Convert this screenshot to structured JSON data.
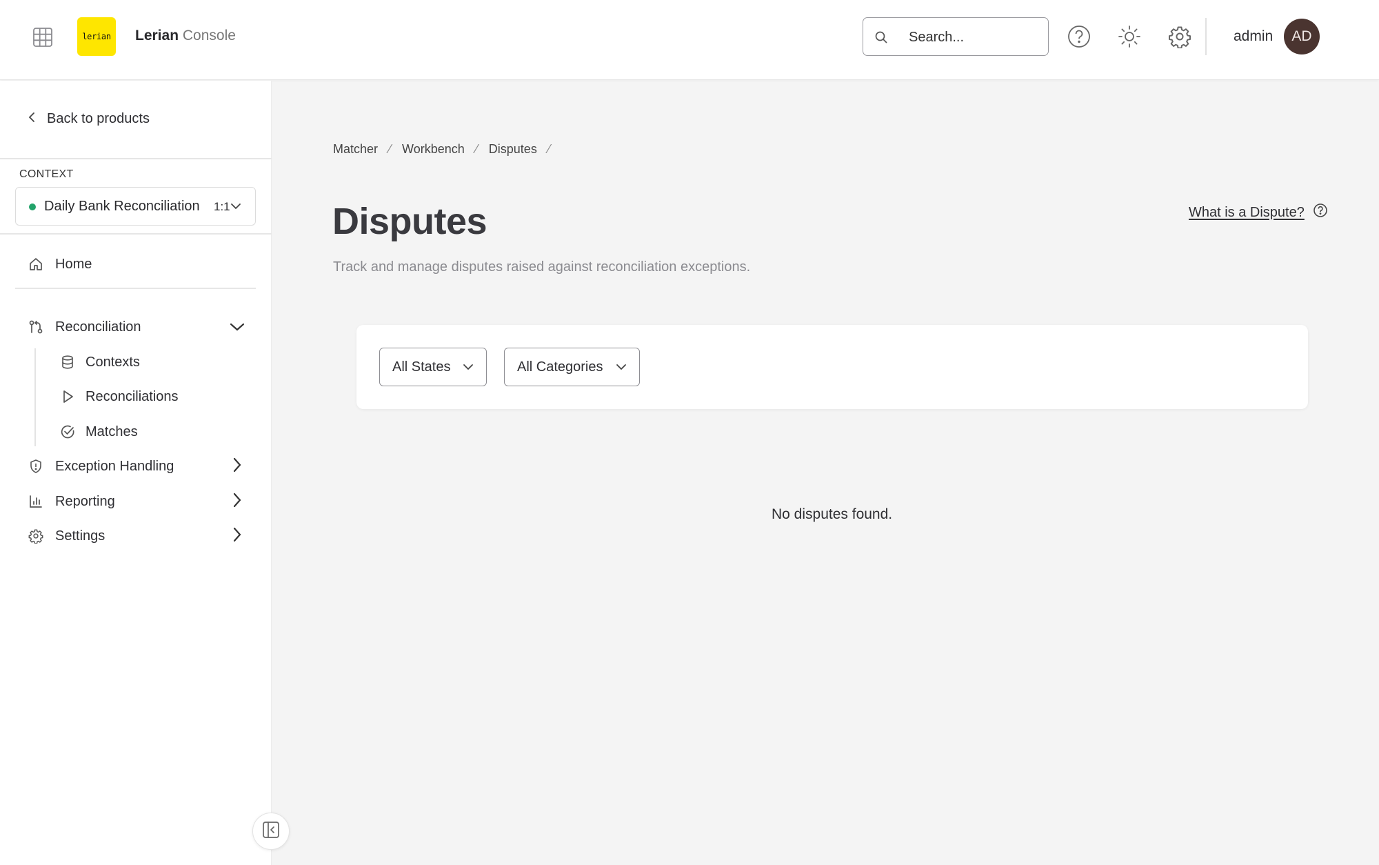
{
  "app": {
    "logo_text": "lerian",
    "brand_name": "Lerian",
    "brand_product": "Console"
  },
  "header": {
    "search_placeholder": "Search...",
    "username": "admin",
    "avatar_initials": "AD",
    "icons": [
      "apps-grid-icon",
      "help-circle-icon",
      "sun-icon",
      "gear-icon"
    ]
  },
  "sidebar": {
    "back_label": "Back to products",
    "context_label": "CONTEXT",
    "context": {
      "name": "Daily Bank Reconciliation",
      "ratio": "1:1",
      "status_color": "#22a36a"
    },
    "home_label": "Home",
    "sections": [
      {
        "label": "Reconciliation",
        "expanded": true,
        "children": [
          "Contexts",
          "Reconciliations",
          "Matches"
        ]
      },
      {
        "label": "Exception Handling",
        "expanded": false
      },
      {
        "label": "Reporting",
        "expanded": false
      },
      {
        "label": "Settings",
        "expanded": false
      }
    ]
  },
  "main": {
    "breadcrumb": [
      "Matcher",
      "Workbench",
      "Disputes"
    ],
    "title": "Disputes",
    "subtitle": "Track and manage disputes raised against reconciliation exceptions.",
    "help_link": "What is a Dispute?",
    "filters": {
      "state": "All States",
      "category": "All Categories"
    },
    "empty_message": "No disputes found."
  },
  "colors": {
    "brand_yellow": "#fee600",
    "avatar_bg": "#4a3430",
    "status_green": "#22a36a"
  }
}
